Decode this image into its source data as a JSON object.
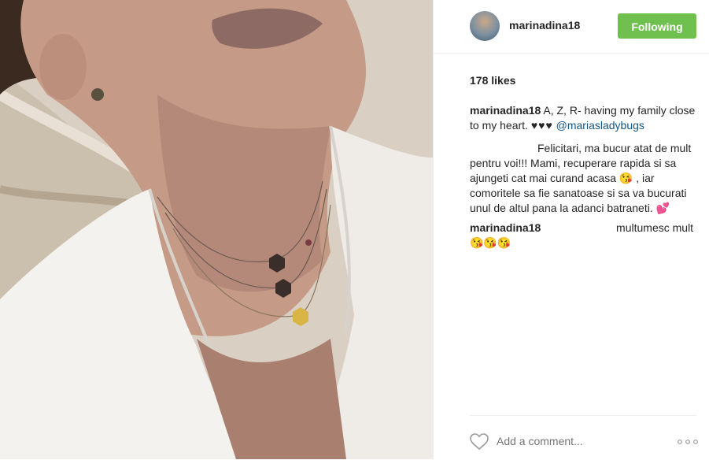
{
  "post": {
    "username": "marinadina18",
    "follow_label": "Following",
    "likes": "178 likes",
    "caption": {
      "user": "marinadina18",
      "text": "A, Z, R- having my family close to my heart.",
      "hearts": "♥♥♥",
      "mention": "@mariasladybugs"
    },
    "comments": [
      {
        "text1": "Felicitari, ma bucur atat de mult pentru voi!!! Mami, recuperare rapida si sa ajungeti cat mai curand acasa",
        "emoji1": "😘",
        "text2": ", iar comoritele sa fie sanatoase si sa va bucurati unul de altul pana la adanci batraneti.",
        "emoji2": "💕"
      },
      {
        "user": "marinadina18",
        "text": "multumesc mult",
        "emoji": "😘😘😘"
      }
    ],
    "add_comment_placeholder": "Add a comment...",
    "more_label": "○○○"
  },
  "icons": {
    "like": "heart-outline-icon",
    "more": "more-options-icon"
  },
  "colors": {
    "follow_bg": "#70c050",
    "mention": "#125688",
    "text": "#262626",
    "placeholder": "#999999"
  }
}
